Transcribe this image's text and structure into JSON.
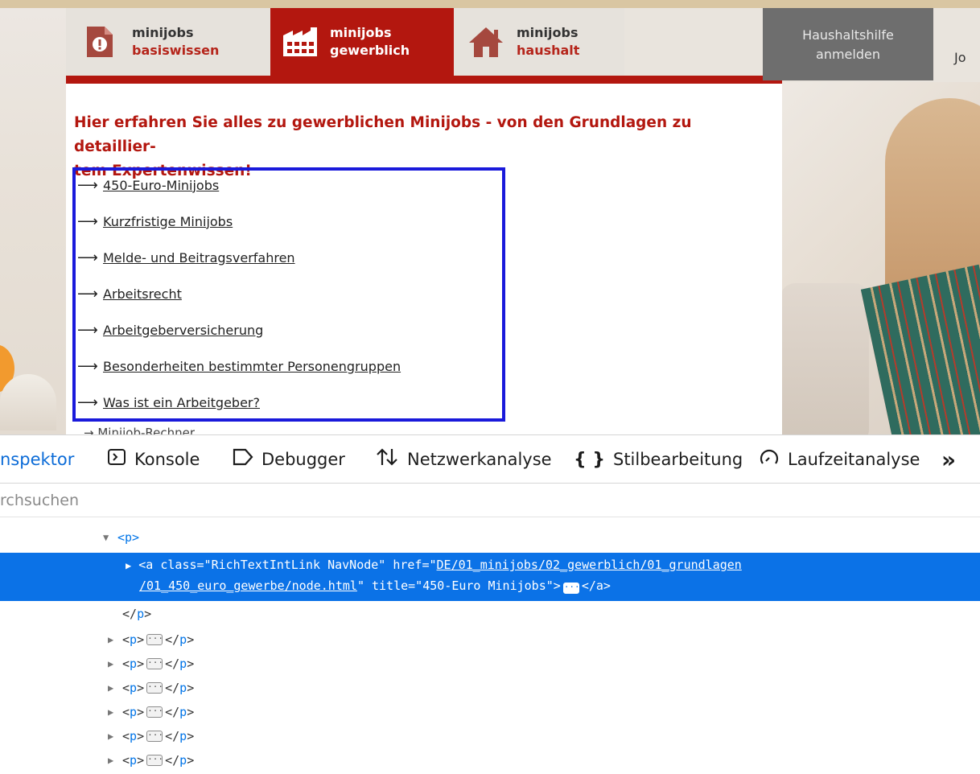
{
  "nav": {
    "basis": {
      "line1": "minijobs",
      "line2": "basiswissen"
    },
    "gewerblich": {
      "line1": "minijobs",
      "line2": "gewerblich"
    },
    "haushalt": {
      "line1": "minijobs",
      "line2": "haushalt"
    },
    "anmelden": {
      "line1": "Haushaltshilfe",
      "line2": "anmelden"
    },
    "cut_item": "Jo"
  },
  "content": {
    "headline_line1": "Hier erfahren Sie alles zu gewerblichen Minijobs - von den Grundlagen zu detaillier-",
    "headline_line2": "tem Expertenwissen!",
    "links": [
      "450-Euro-Minijobs",
      "Kurzfristige Minijobs",
      "Melde- und Beitragsverfahren",
      "Arbeitsrecht",
      "Arbeitgeberversicherung",
      "Besonderheiten bestimmter Personengruppen",
      "Was ist ein Arbeitgeber?"
    ],
    "link_prefix": "⟶",
    "peek": "→ Minijob-Rechner"
  },
  "devtools": {
    "tabs": {
      "inspektor": "nspektor",
      "konsole": "Konsole",
      "debugger": "Debugger",
      "netz": "Netzwerkanalyse",
      "stil": "Stilbearbeitung",
      "laufzeit": "Laufzeitanalyse",
      "more": "»"
    },
    "search_placeholder": "rchsuchen",
    "tree": {
      "p_open": "<p>",
      "p_close": "</p>",
      "p_tag": "p",
      "selected_line1_pre": "<a class=\"RichTextIntLink NavNode\" href=\"",
      "selected_href_1": "DE/01_minijobs/02_gewerblich/01_grundlagen",
      "selected_href_2": "/01_450_euro_gewerbe/node.html",
      "selected_line2_post": "\" title=\"450-Euro Minijobs\">",
      "selected_end": "</a>",
      "dots": "···"
    }
  }
}
